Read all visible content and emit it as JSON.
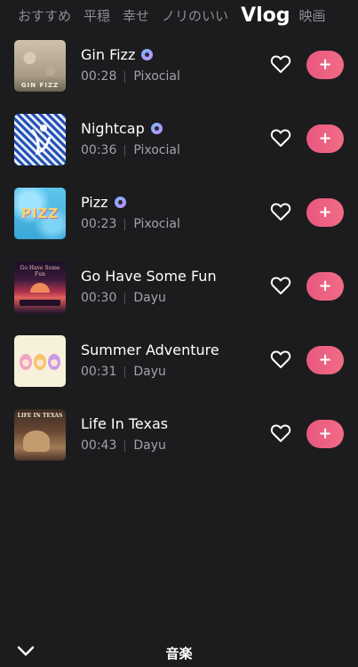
{
  "tabs": [
    {
      "label": "おすすめ"
    },
    {
      "label": "平穏"
    },
    {
      "label": "幸せ"
    },
    {
      "label": "ノリのいい"
    },
    {
      "label": "Vlog",
      "active": true
    },
    {
      "label": "映画"
    }
  ],
  "tracks": [
    {
      "title": "Gin Fizz",
      "verified": true,
      "duration": "00:28",
      "artist": "Pixocial",
      "add_label": "+",
      "thumb_icon": "gin-fizz-cover"
    },
    {
      "title": "Nightcap",
      "verified": true,
      "duration": "00:36",
      "artist": "Pixocial",
      "add_label": "+",
      "thumb_icon": "nightcap-cover"
    },
    {
      "title": "Pizz",
      "verified": true,
      "duration": "00:23",
      "artist": "Pixocial",
      "add_label": "+",
      "thumb_icon": "pizz-cover"
    },
    {
      "title": "Go Have Some Fun",
      "verified": false,
      "duration": "00:30",
      "artist": "Dayu",
      "add_label": "+",
      "thumb_icon": "go-have-some-fun-cover",
      "cover_text": "Go Have Some Fun"
    },
    {
      "title": "Summer Adventure",
      "verified": false,
      "duration": "00:31",
      "artist": "Dayu",
      "add_label": "+",
      "thumb_icon": "summer-adventure-cover"
    },
    {
      "title": "Life In Texas",
      "verified": false,
      "duration": "00:43",
      "artist": "Dayu",
      "add_label": "+",
      "thumb_icon": "life-in-texas-cover",
      "cover_text": "LIFE IN TEXAS"
    }
  ],
  "bottom": {
    "title": "音楽",
    "collapse_icon": "chevron-down-icon"
  },
  "colors": {
    "background": "#1c1c1e",
    "accent": "#ee6584",
    "text_secondary": "#a3a3a8"
  }
}
